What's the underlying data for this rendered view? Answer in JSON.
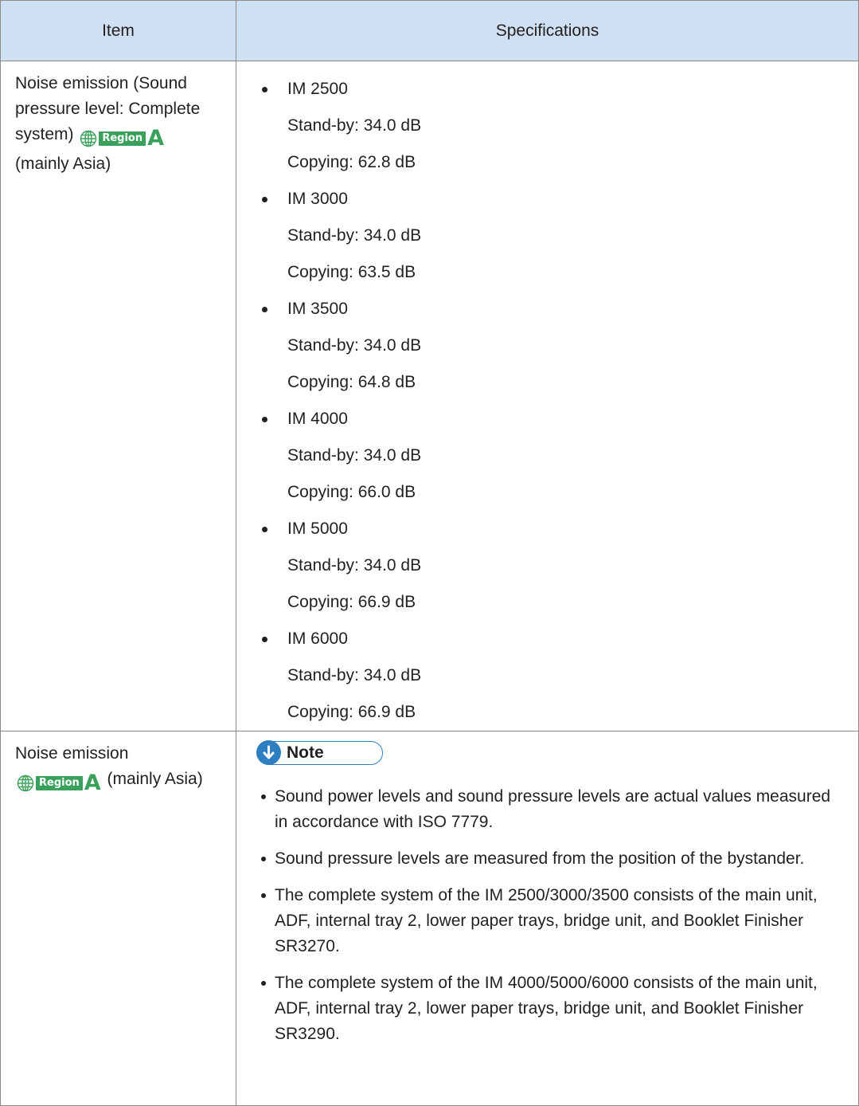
{
  "header": {
    "item": "Item",
    "specifications": "Specifications"
  },
  "region_badge": {
    "label": "Region",
    "letter": "A",
    "color": "#3aa15c",
    "icon": "globe-icon"
  },
  "row1": {
    "item_before": "Noise emission (Sound pressure level: Complete system)",
    "item_after": "(mainly Asia)",
    "models": [
      {
        "name": "IM 2500",
        "standby": "Stand-by: 34.0 dB",
        "copying": "Copying: 62.8 dB"
      },
      {
        "name": "IM 3000",
        "standby": "Stand-by: 34.0 dB",
        "copying": "Copying: 63.5 dB"
      },
      {
        "name": "IM 3500",
        "standby": "Stand-by: 34.0 dB",
        "copying": "Copying: 64.8 dB"
      },
      {
        "name": "IM 4000",
        "standby": "Stand-by: 34.0 dB",
        "copying": "Copying: 66.0 dB"
      },
      {
        "name": "IM 5000",
        "standby": "Stand-by: 34.0 dB",
        "copying": "Copying: 66.9 dB"
      },
      {
        "name": "IM 6000",
        "standby": "Stand-by: 34.0 dB",
        "copying": "Copying: 66.9 dB"
      }
    ]
  },
  "row2": {
    "item_before": "Noise emission",
    "item_after": "(mainly Asia)",
    "note_title": "Note",
    "note_icon": "down-arrow-icon",
    "note_color": "#2d7fc1",
    "notes": [
      "Sound power levels and sound pressure levels are actual values measured in accordance with ISO 7779.",
      "Sound pressure levels are measured from the position of the bystander.",
      "The complete system of the IM 2500/3000/3500 consists of the main unit, ADF, internal tray 2, lower paper trays, bridge unit, and Booklet Finisher SR3270.",
      "The complete system of the IM 4000/5000/6000 consists of the main unit, ADF, internal tray 2, lower paper trays, bridge unit, and Booklet Finisher SR3290."
    ]
  }
}
